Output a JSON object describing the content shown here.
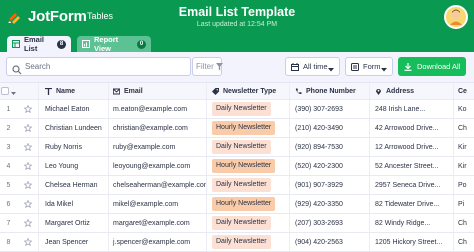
{
  "header": {
    "logo_text": "JotForm",
    "app_name": "Tables",
    "title": "Email List Template",
    "subtitle": "Last updated at 12:54 PM"
  },
  "tabs": [
    {
      "label": "Email List",
      "count": "8"
    },
    {
      "label": "Report View",
      "count": "0"
    }
  ],
  "toolbar": {
    "search_placeholder": "Search",
    "filter_label": "Filter",
    "time_label": "All time",
    "form_label": "Form",
    "download_label": "Download All"
  },
  "table": {
    "columns": [
      "Name",
      "Email",
      "Newsletter Type",
      "Phone Number",
      "Address",
      "Ce"
    ],
    "rows": [
      {
        "num": "1",
        "name": "Michael Eaton",
        "email": "m.eaton@example.com",
        "newsletter": "Daily Newsletter",
        "phone": "(390) 307-2693",
        "address": "248 Irish Lane...",
        "city": "Ko"
      },
      {
        "num": "2",
        "name": "Christian Lundeen",
        "email": "christian@example.com",
        "newsletter": "Hourly Newsletter",
        "phone": "(210) 420-3490",
        "address": "42 Arrowood Drive...",
        "city": "Ch"
      },
      {
        "num": "3",
        "name": "Ruby Norris",
        "email": "ruby@example.com",
        "newsletter": "Daily Newsletter",
        "phone": "(920) 894-7530",
        "address": "12 Arrowood Drive...",
        "city": "Kir"
      },
      {
        "num": "4",
        "name": "Leo Young",
        "email": "leoyoung@example.com",
        "newsletter": "Hourly Newsletter",
        "phone": "(520) 420-2300",
        "address": "52 Ancester Street...",
        "city": "Kir"
      },
      {
        "num": "5",
        "name": "Chelsea Herman",
        "email": "chelseaherman@example.com",
        "newsletter": "Daily Newsletter",
        "phone": "(901) 907-3929",
        "address": "2957 Seneca Drive...",
        "city": "Po"
      },
      {
        "num": "6",
        "name": "Ida Mikel",
        "email": "mikel@example.com",
        "newsletter": "Hourly Newsletter",
        "phone": "(929) 420-3350",
        "address": "82 Tidewater Drive...",
        "city": "Pi"
      },
      {
        "num": "7",
        "name": "Margaret Ortiz",
        "email": "margaret@example.com",
        "newsletter": "Daily Newsletter",
        "phone": "(207) 303-2693",
        "address": "82 Windy Ridge...",
        "city": "Ch"
      },
      {
        "num": "8",
        "name": "Jean Spencer",
        "email": "j.spencer@example.com",
        "newsletter": "Daily Newsletter",
        "phone": "(904) 420-2563",
        "address": "1205 Hickory Street...",
        "city": "Ch"
      }
    ]
  },
  "colors": {
    "brand_green": "#0a9950",
    "download_green": "#18bd5b",
    "pill_daily": "#fde0d4",
    "pill_hourly": "#f9cba8"
  },
  "icons": {
    "logo": "jotform-logo-icon",
    "search": "search-icon",
    "filter": "filter-icon",
    "calendar": "calendar-icon",
    "form": "form-icon",
    "download": "download-icon"
  }
}
